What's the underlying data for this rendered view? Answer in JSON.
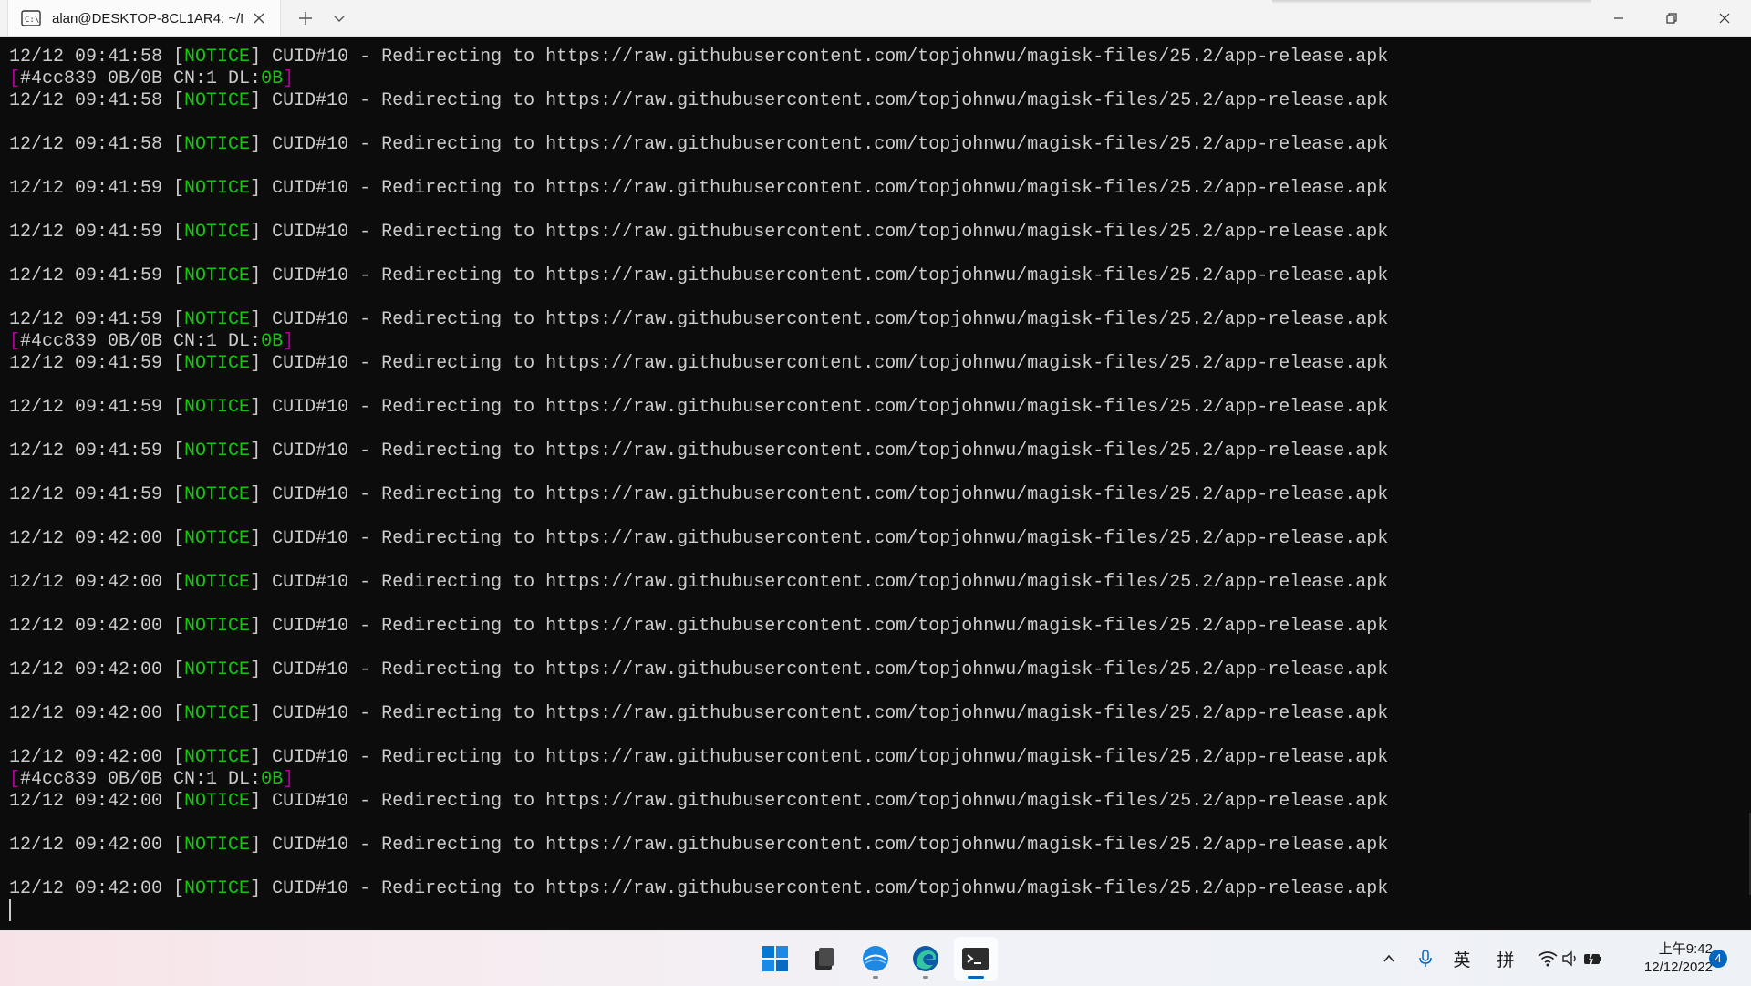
{
  "window": {
    "tab_title": "alan@DESKTOP-8CL1AR4: ~/M",
    "tab_icon": "terminal-tab-icon",
    "new_tab_icon": "plus-icon",
    "dropdown_icon": "chevron-down-icon"
  },
  "log": {
    "notice_label": "NOTICE",
    "cuid": "CUID#10",
    "message": "Redirecting to",
    "url": "https://raw.githubusercontent.com/topjohnwu/magisk-files/25.2/app-release.apk",
    "progress_prefix": "#4cc839 0B/0B CN:1 DL:",
    "progress_dl": "0B",
    "lines": [
      {
        "kind": "notice",
        "time": "12/12 09:41:58"
      },
      {
        "kind": "progress"
      },
      {
        "kind": "notice",
        "time": "12/12 09:41:58"
      },
      {
        "kind": "blank"
      },
      {
        "kind": "notice",
        "time": "12/12 09:41:58"
      },
      {
        "kind": "blank"
      },
      {
        "kind": "notice",
        "time": "12/12 09:41:59"
      },
      {
        "kind": "blank"
      },
      {
        "kind": "notice",
        "time": "12/12 09:41:59"
      },
      {
        "kind": "blank"
      },
      {
        "kind": "notice",
        "time": "12/12 09:41:59"
      },
      {
        "kind": "blank"
      },
      {
        "kind": "notice",
        "time": "12/12 09:41:59"
      },
      {
        "kind": "progress"
      },
      {
        "kind": "notice",
        "time": "12/12 09:41:59"
      },
      {
        "kind": "blank"
      },
      {
        "kind": "notice",
        "time": "12/12 09:41:59"
      },
      {
        "kind": "blank"
      },
      {
        "kind": "notice",
        "time": "12/12 09:41:59"
      },
      {
        "kind": "blank"
      },
      {
        "kind": "notice",
        "time": "12/12 09:41:59"
      },
      {
        "kind": "blank"
      },
      {
        "kind": "notice",
        "time": "12/12 09:42:00"
      },
      {
        "kind": "blank"
      },
      {
        "kind": "notice",
        "time": "12/12 09:42:00"
      },
      {
        "kind": "blank"
      },
      {
        "kind": "notice",
        "time": "12/12 09:42:00"
      },
      {
        "kind": "blank"
      },
      {
        "kind": "notice",
        "time": "12/12 09:42:00"
      },
      {
        "kind": "blank"
      },
      {
        "kind": "notice",
        "time": "12/12 09:42:00"
      },
      {
        "kind": "blank"
      },
      {
        "kind": "notice",
        "time": "12/12 09:42:00"
      },
      {
        "kind": "progress"
      },
      {
        "kind": "notice",
        "time": "12/12 09:42:00"
      },
      {
        "kind": "blank"
      },
      {
        "kind": "notice",
        "time": "12/12 09:42:00"
      },
      {
        "kind": "blank"
      },
      {
        "kind": "notice",
        "time": "12/12 09:42:00"
      }
    ]
  },
  "taskbar": {
    "apps": [
      "start-button",
      "file-explorer",
      "browser",
      "edge",
      "terminal"
    ],
    "tray": {
      "ime_lang": "英",
      "ime_mode": "拼"
    },
    "clock_time": "上午9:42",
    "clock_date": "12/12/2022",
    "notification_count": "4"
  },
  "colors": {
    "terminal_bg": "#0c0c0c",
    "terminal_fg": "#cccccc",
    "notice_green": "#16c60c",
    "bracket_magenta": "#b4009e",
    "accent": "#0067c0"
  }
}
